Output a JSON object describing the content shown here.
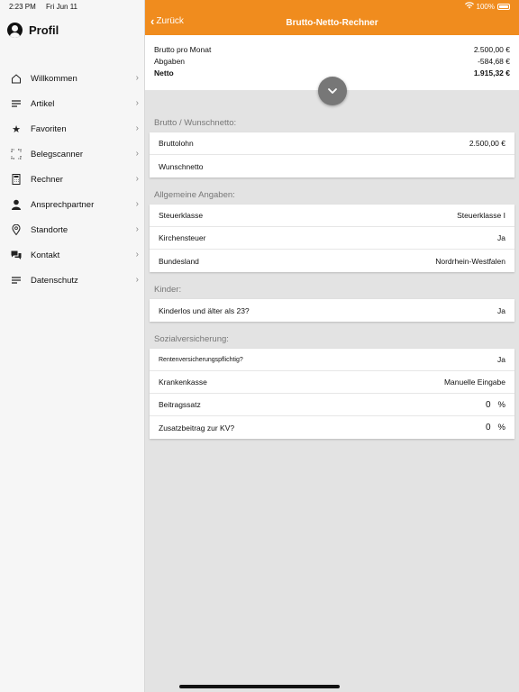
{
  "status": {
    "time": "2:23 PM",
    "date": "Fri Jun 11",
    "battery": "100%"
  },
  "sidebar": {
    "title": "Profil",
    "items": [
      {
        "label": "Willkommen",
        "icon": "home-icon"
      },
      {
        "label": "Artikel",
        "icon": "list-icon"
      },
      {
        "label": "Favoriten",
        "icon": "star-icon"
      },
      {
        "label": "Belegscanner",
        "icon": "scan-icon"
      },
      {
        "label": "Rechner",
        "icon": "calculator-icon"
      },
      {
        "label": "Ansprechpartner",
        "icon": "person-icon"
      },
      {
        "label": "Standorte",
        "icon": "location-pin-icon"
      },
      {
        "label": "Kontakt",
        "icon": "chat-icon"
      },
      {
        "label": "Datenschutz",
        "icon": "list-icon"
      }
    ]
  },
  "header": {
    "back_label": "Zurück",
    "title": "Brutto-Netto-Rechner",
    "color": "#f08c1e"
  },
  "summary": {
    "brutto_label": "Brutto pro Monat",
    "brutto_value": "2.500,00 €",
    "abgaben_label": "Abgaben",
    "abgaben_value": "-584,68 €",
    "netto_label": "Netto",
    "netto_value": "1.915,32 €"
  },
  "sections": {
    "brutto": {
      "title": "Brutto / Wunschnetto:",
      "rows": [
        {
          "label": "Bruttolohn",
          "value": "2.500,00 €"
        },
        {
          "label": "Wunschnetto",
          "value": ""
        }
      ]
    },
    "allgemein": {
      "title": "Allgemeine Angaben:",
      "rows": [
        {
          "label": "Steuerklasse",
          "value": "Steuerklasse I"
        },
        {
          "label": "Kirchensteuer",
          "value": "Ja"
        },
        {
          "label": "Bundesland",
          "value": "Nordrhein-Westfalen"
        }
      ]
    },
    "kinder": {
      "title": "Kinder:",
      "rows": [
        {
          "label": "Kinderlos und älter als 23?",
          "value": "Ja"
        }
      ]
    },
    "sozial": {
      "title": "Sozialversicherung:",
      "rows": [
        {
          "label": "Rentenversicherungspflichtig?",
          "value": "Ja"
        },
        {
          "label": "Krankenkasse",
          "value": "Manuelle Eingabe"
        },
        {
          "label": "Beitragssatz",
          "value": "0",
          "unit": "%"
        },
        {
          "label": "Zusatzbeitrag zur KV?",
          "value": "0",
          "unit": "%"
        }
      ]
    }
  }
}
